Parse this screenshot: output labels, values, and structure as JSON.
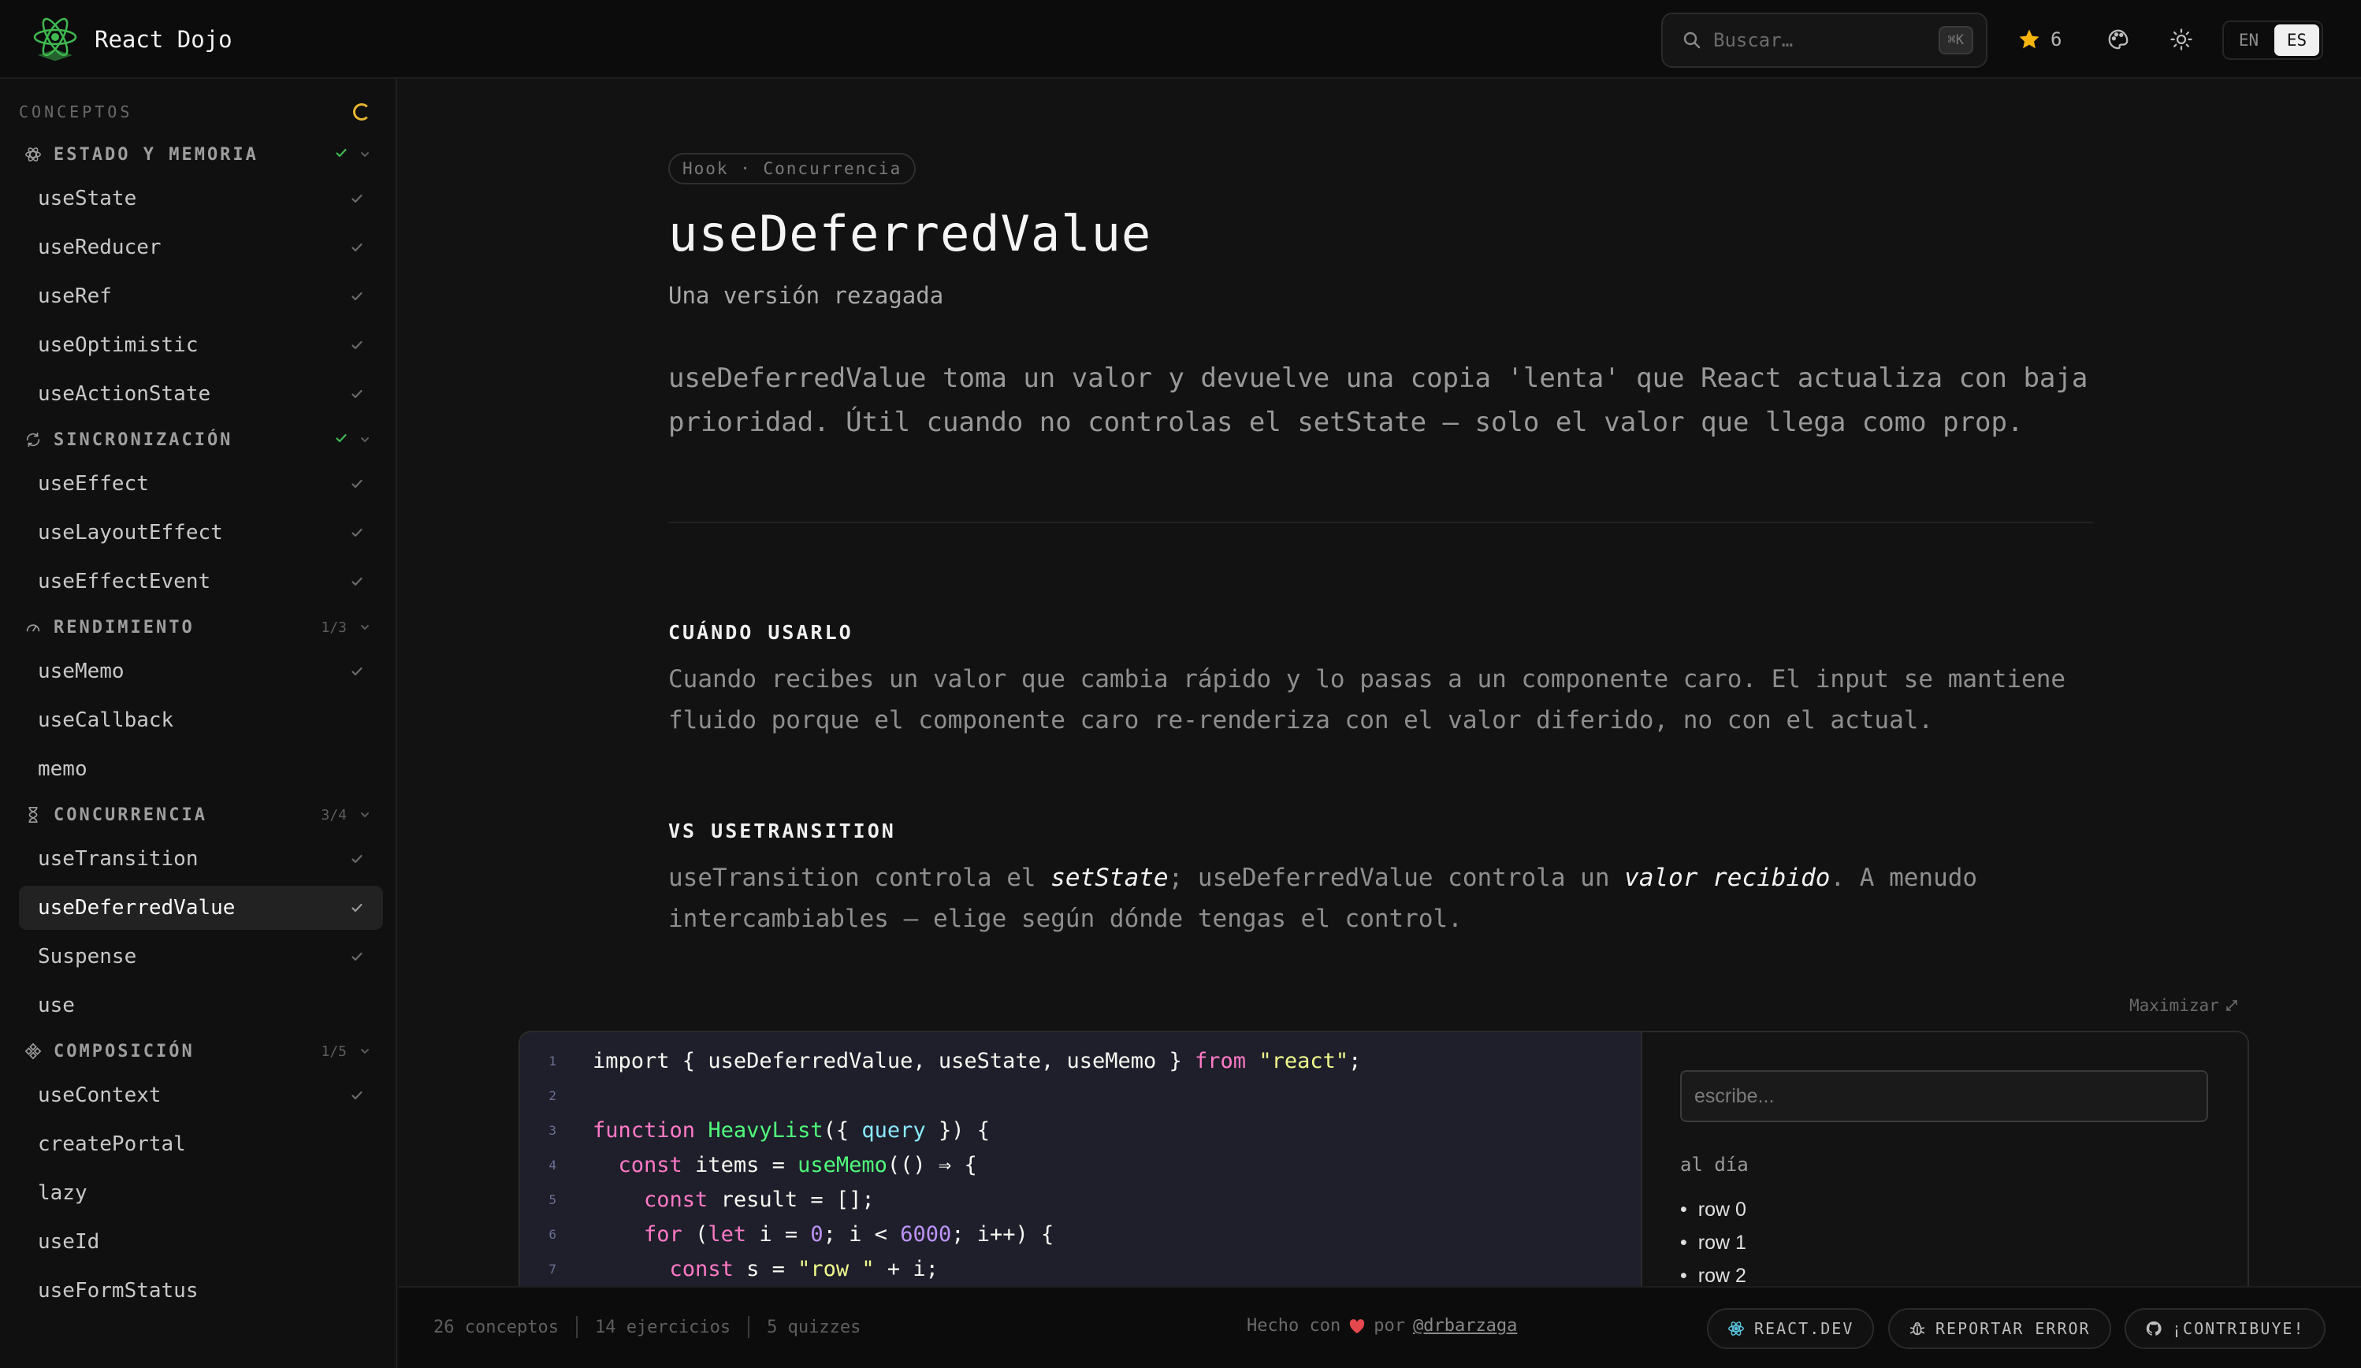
{
  "app": {
    "name": "React Dojo",
    "search_placeholder": "Buscar…",
    "search_shortcut": "⌘K",
    "stars": "6",
    "lang_en": "EN",
    "lang_es": "ES",
    "active_lang": "ES",
    "accent_color": "#e7b431"
  },
  "sidebar": {
    "heading": "CONCEPTOS",
    "groups": [
      {
        "label": "ESTADO Y MEMORIA",
        "icon": "atom-icon",
        "status": "complete",
        "items": [
          {
            "label": "useState",
            "done": true
          },
          {
            "label": "useReducer",
            "done": true
          },
          {
            "label": "useRef",
            "done": true
          },
          {
            "label": "useOptimistic",
            "done": true
          },
          {
            "label": "useActionState",
            "done": true
          }
        ]
      },
      {
        "label": "SINCRONIZACIÓN",
        "icon": "sync-icon",
        "status": "complete",
        "items": [
          {
            "label": "useEffect",
            "done": true
          },
          {
            "label": "useLayoutEffect",
            "done": true
          },
          {
            "label": "useEffectEvent",
            "done": true
          }
        ]
      },
      {
        "label": "RENDIMIENTO",
        "icon": "gauge-icon",
        "count": "1/3",
        "items": [
          {
            "label": "useMemo",
            "done": true
          },
          {
            "label": "useCallback",
            "done": false
          },
          {
            "label": "memo",
            "done": false
          }
        ]
      },
      {
        "label": "CONCURRENCIA",
        "icon": "hourglass-icon",
        "count": "3/4",
        "items": [
          {
            "label": "useTransition",
            "done": true
          },
          {
            "label": "useDeferredValue",
            "done": true,
            "active": true
          },
          {
            "label": "Suspense",
            "done": true
          },
          {
            "label": "use",
            "done": false
          }
        ]
      },
      {
        "label": "COMPOSICIÓN",
        "icon": "components-icon",
        "count": "1/5",
        "items": [
          {
            "label": "useContext",
            "done": true
          },
          {
            "label": "createPortal",
            "done": false
          },
          {
            "label": "lazy",
            "done": false
          },
          {
            "label": "useId",
            "done": false
          },
          {
            "label": "useFormStatus",
            "done": false
          }
        ]
      }
    ]
  },
  "page": {
    "tag": "Hook · Concurrencia",
    "title": "useDeferredValue",
    "subtitle": "Una versión rezagada",
    "intro": "useDeferredValue toma un valor y devuelve una copia 'lenta' que React actualiza con baja prioridad. Útil cuando no controlas el setState — solo el valor que llega como prop.",
    "when_heading": "CUÁNDO USARLO",
    "when_text": "Cuando recibes un valor que cambia rápido y lo pasas a un componente caro. El input se mantiene fluido porque el componente caro re-renderiza con el valor diferido, no con el actual.",
    "vs_heading": "VS USETRANSITION",
    "vs_text_1": "useTransition controla el ",
    "vs_em_1": "setState",
    "vs_text_2": "; useDeferredValue controla un ",
    "vs_em_2": "valor recibido",
    "vs_text_3": ". A menudo intercambiables — elige según dónde tengas el control.",
    "maximize": "Maximizar"
  },
  "code": {
    "lines": [
      {
        "n": "1",
        "tokens": [
          [
            "kw2",
            "import"
          ],
          [
            "p",
            " { useDeferredValue, useState, useMemo } "
          ],
          [
            "kw",
            "from"
          ],
          [
            "p",
            " "
          ],
          [
            "str",
            "\"react\""
          ],
          [
            "p",
            ";"
          ]
        ]
      },
      {
        "n": "2",
        "tokens": []
      },
      {
        "n": "3",
        "tokens": [
          [
            "kw",
            "function"
          ],
          [
            "p",
            " "
          ],
          [
            "fn",
            "HeavyList"
          ],
          [
            "p",
            "({ "
          ],
          [
            "prm",
            "query"
          ],
          [
            "p",
            " }) {"
          ]
        ]
      },
      {
        "n": "4",
        "tokens": [
          [
            "p",
            "  "
          ],
          [
            "kw",
            "const"
          ],
          [
            "p",
            " items = "
          ],
          [
            "fn",
            "useMemo"
          ],
          [
            "p",
            "(() ⇒ {"
          ]
        ]
      },
      {
        "n": "5",
        "tokens": [
          [
            "p",
            "    "
          ],
          [
            "kw",
            "const"
          ],
          [
            "p",
            " result = [];"
          ]
        ]
      },
      {
        "n": "6",
        "tokens": [
          [
            "p",
            "    "
          ],
          [
            "kw",
            "for"
          ],
          [
            "p",
            " ("
          ],
          [
            "kw",
            "let"
          ],
          [
            "p",
            " i = "
          ],
          [
            "num",
            "0"
          ],
          [
            "p",
            "; i < "
          ],
          [
            "num",
            "6000"
          ],
          [
            "p",
            "; i++) {"
          ]
        ]
      },
      {
        "n": "7",
        "tokens": [
          [
            "p",
            "      "
          ],
          [
            "kw",
            "const"
          ],
          [
            "p",
            " s = "
          ],
          [
            "str",
            "\"row \""
          ],
          [
            "p",
            " + i;"
          ]
        ]
      }
    ]
  },
  "preview": {
    "input_placeholder": "escribe...",
    "label": "al día",
    "rows": [
      "row 0",
      "row 1",
      "row 2"
    ]
  },
  "footer": {
    "concepts": "26 conceptos",
    "exercises": "14 ejercicios",
    "quizzes": "5 quizzes",
    "made_with": "Hecho con",
    "by": "por",
    "handle": "@drbarzaga",
    "btn_react": "REACT.DEV",
    "btn_report": "REPORTAR ERROR",
    "btn_contribute": "¡CONTRIBUYE!"
  }
}
